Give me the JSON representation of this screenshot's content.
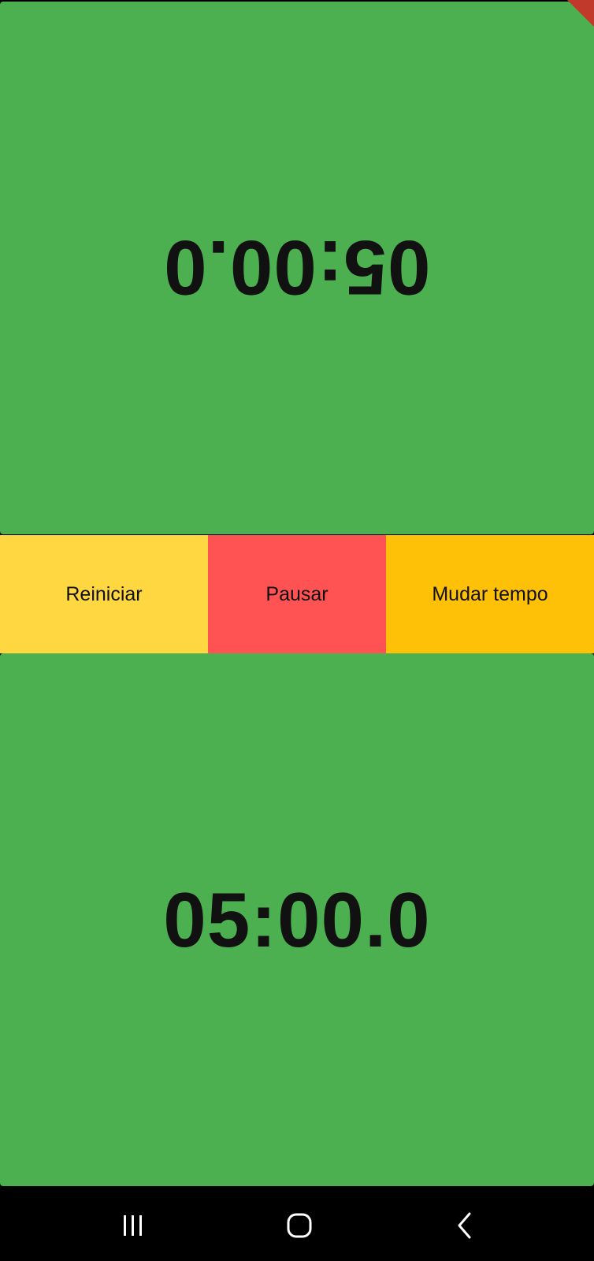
{
  "top_timer": {
    "time": "05:00.0"
  },
  "controls": {
    "reset_label": "Reiniciar",
    "pause_label": "Pausar",
    "change_time_label": "Mudar tempo"
  },
  "bottom_timer": {
    "time": "05:00.0"
  },
  "colors": {
    "timer_background": "#4caf50",
    "reset_button": "#ffd740",
    "pause_button": "#ff5252",
    "change_time_button": "#ffc107",
    "corner_flag": "#c0392b",
    "nav_bar": "#000000"
  },
  "nav": {
    "icons": [
      "recent-apps-icon",
      "home-icon",
      "back-icon"
    ]
  }
}
